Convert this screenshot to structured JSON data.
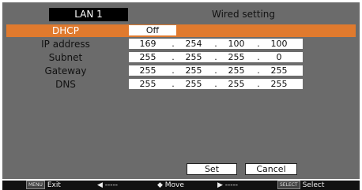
{
  "header": {
    "tab_title": "LAN 1",
    "title": "Wired setting"
  },
  "rows": [
    {
      "label": "DHCP",
      "value": "Off"
    },
    {
      "label": "IP address",
      "octets": [
        "169",
        "254",
        "100",
        "100"
      ]
    },
    {
      "label": "Subnet",
      "octets": [
        "255",
        "255",
        "255",
        "0"
      ]
    },
    {
      "label": "Gateway",
      "octets": [
        "255",
        "255",
        "255",
        "255"
      ]
    },
    {
      "label": "DNS",
      "octets": [
        "255",
        "255",
        "255",
        "255"
      ]
    }
  ],
  "buttons": {
    "set": "Set",
    "cancel": "Cancel"
  },
  "statusbar": {
    "menu_key": "MENU",
    "exit": "Exit",
    "left": "◀ -----",
    "move": "◆ Move",
    "right": "▶ -----",
    "select_key": "SELECT",
    "select": "Select"
  },
  "colors": {
    "panel": "#6b6b6b",
    "highlight": "#e07a2e",
    "statusbar": "#111111"
  }
}
